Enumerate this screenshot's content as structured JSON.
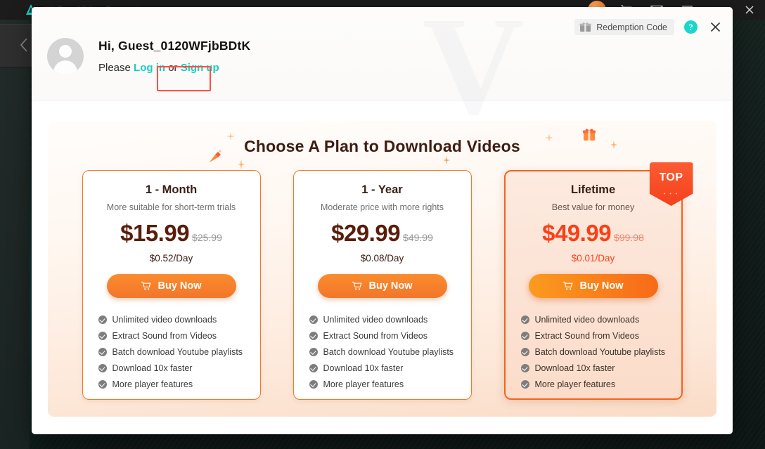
{
  "background_app": {
    "title": "HitPaw Video Converter",
    "logo_icon": "teal-triangle-logo",
    "back_icon": "chevron-left-icon",
    "window_controls": [
      {
        "name": "cart-icon",
        "glyph": "cart"
      },
      {
        "name": "mail-icon",
        "glyph": "mail"
      },
      {
        "name": "restore-icon",
        "glyph": "restore"
      },
      {
        "name": "minimize-icon",
        "glyph": "minimize"
      },
      {
        "name": "close-icon",
        "glyph": "close"
      }
    ]
  },
  "header": {
    "redemption_label": "Redemption Code",
    "gift_icon": "gift-icon",
    "help_icon": "question-mark-icon",
    "close_icon": "close-icon",
    "greeting": "Hi, Guest_0120WFjbBDtK",
    "auth_prefix": "Please",
    "login_label": "Log in",
    "auth_separator": "or",
    "signup_label": "Sign up",
    "avatar_icon": "user-avatar-icon"
  },
  "panel": {
    "title": "Choose A Plan to Download Videos"
  },
  "plans": [
    {
      "name": "1 - Month",
      "subtitle": "More suitable for short-term trials",
      "price": "$15.99",
      "price_old": "$25.99",
      "price_day": "$0.52/Day",
      "buy_label": "Buy Now",
      "featured": false,
      "features": [
        "Unlimited video downloads",
        "Extract Sound from Videos",
        "Batch download Youtube playlists",
        "Download 10x faster",
        "More player features"
      ]
    },
    {
      "name": "1 - Year",
      "subtitle": "Moderate price with more rights",
      "price": "$29.99",
      "price_old": "$49.99",
      "price_day": "$0.08/Day",
      "buy_label": "Buy Now",
      "featured": false,
      "features": [
        "Unlimited video downloads",
        "Extract Sound from Videos",
        "Batch download Youtube playlists",
        "Download 10x faster",
        "More player features"
      ]
    },
    {
      "name": "Lifetime",
      "subtitle": "Best value for money",
      "price": "$49.99",
      "price_old": "$99.98",
      "price_day": "$0.01/Day",
      "buy_label": "Buy Now",
      "featured": true,
      "badge": "TOP",
      "features": [
        "Unlimited video downloads",
        "Extract Sound from Videos",
        "Batch download Youtube playlists",
        "Download 10x faster",
        "More player features"
      ]
    }
  ],
  "colors": {
    "accent_orange": "#f2762a",
    "accent_red": "#fb3f17",
    "link_cyan": "#14cfc4",
    "highlight_box": "#ff4f3f",
    "title_brown": "#3d1d12"
  }
}
